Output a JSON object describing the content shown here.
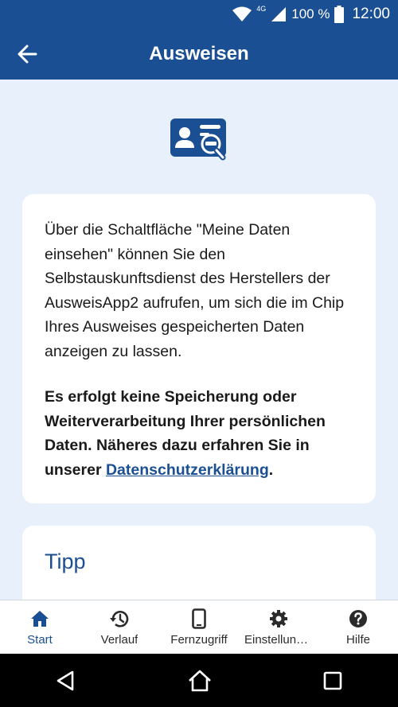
{
  "status_bar": {
    "network": "4G",
    "battery": "100 %",
    "time": "12:00"
  },
  "app_bar": {
    "title": "Ausweisen"
  },
  "card_info": {
    "paragraph1": "Über die Schaltfläche \"Meine Daten einsehen\" können Sie den Selbstauskunftsdienst des Herstellers der AusweisApp2 aufrufen, um sich die im Chip Ihres Ausweises gespeicherten Daten anzeigen zu lassen.",
    "paragraph2_text": "Es erfolgt keine Speicherung oder Weiterverarbeitung Ihrer persönlichen Daten. Näheres dazu erfahren Sie in unserer ",
    "paragraph2_link": "Datenschutzerklärung",
    "paragraph2_end": "."
  },
  "card_tip": {
    "title": "Tipp"
  },
  "bottom_nav": {
    "items": [
      {
        "label": "Start",
        "icon": "home-icon",
        "active": true
      },
      {
        "label": "Verlauf",
        "icon": "history-icon"
      },
      {
        "label": "Fernzugriff",
        "icon": "smartphone-icon"
      },
      {
        "label": "Einstellungen",
        "icon": "gear-icon"
      },
      {
        "label": "Hilfe",
        "icon": "help-icon"
      }
    ]
  },
  "colors": {
    "primary": "#1b4f93",
    "background": "#e8f0fb",
    "card": "#ffffff"
  }
}
